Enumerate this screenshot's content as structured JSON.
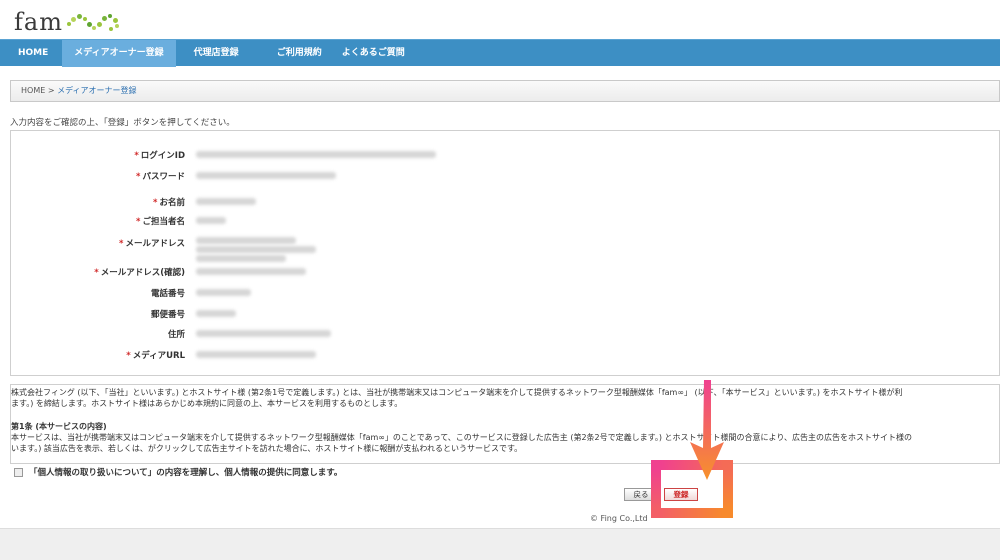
{
  "logo": {
    "text": "fam"
  },
  "nav": {
    "items": [
      "HOME",
      "メディアオーナー登録",
      "代理店登録",
      "ご利用規約",
      "よくあるご質問"
    ]
  },
  "breadcrumb": {
    "home": "HOME",
    "separator": ">",
    "current": "メディアオーナー登録"
  },
  "instruction": "入力内容をご確認の上、「登録」ボタンを押してください。",
  "form": {
    "required_mark": "*",
    "fields": [
      {
        "label": "ログインID",
        "required": true
      },
      {
        "label": "パスワード",
        "required": true
      },
      {
        "label": "お名前",
        "required": true
      },
      {
        "label": "ご担当者名",
        "required": true
      },
      {
        "label": "メールアドレス",
        "required": true
      },
      {
        "label": "メールアドレス(確認)",
        "required": true
      },
      {
        "label": "電話番号",
        "required": false
      },
      {
        "label": "郵便番号",
        "required": false
      },
      {
        "label": "住所",
        "required": false
      },
      {
        "label": "メディアURL",
        "required": true
      }
    ]
  },
  "terms": {
    "line1": "株式会社フィング (以下、「当社」といいます。) とホストサイト様 (第2条1号で定義します。) とは、当社が携帯端末又はコンピュータ端末を介して提供するネットワーク型報酬媒体「fam∞」 (以下、「本サービス」といいます。) をホストサイト様が利",
    "line2": "ます。) を締結します。ホストサイト様はあらかじめ本規約に同意の上、本サービスを利用するものとします。",
    "heading": "第1条 (本サービスの内容)",
    "line3": "本サービスは、当社が携帯端末又はコンピュータ端末を介して提供するネットワーク型報酬媒体「fam∞」のことであって、このサービスに登録した広告主 (第2条2号で定義します。) とホストサイト様間の合意により、広告主の広告をホストサイト様の",
    "line4": "います。) 該当広告を表示、若しくは、がクリックして広告主サイトを訪れた場合に、ホストサイト様に報酬が支払われるというサービスです。"
  },
  "agree_text": "「個人情報の取り扱いについて」の内容を理解し、個人情報の提供に同意します。",
  "buttons": {
    "back": "戻る",
    "submit": "登録"
  },
  "footer": {
    "copyright": "© Fing Co.,Ltd"
  },
  "colors": {
    "nav": "#3d8fc4",
    "nav_active": "#6aaede",
    "required": "#d12a2a",
    "annotation_pink": "#f04090",
    "annotation_orange": "#f78a2c"
  }
}
